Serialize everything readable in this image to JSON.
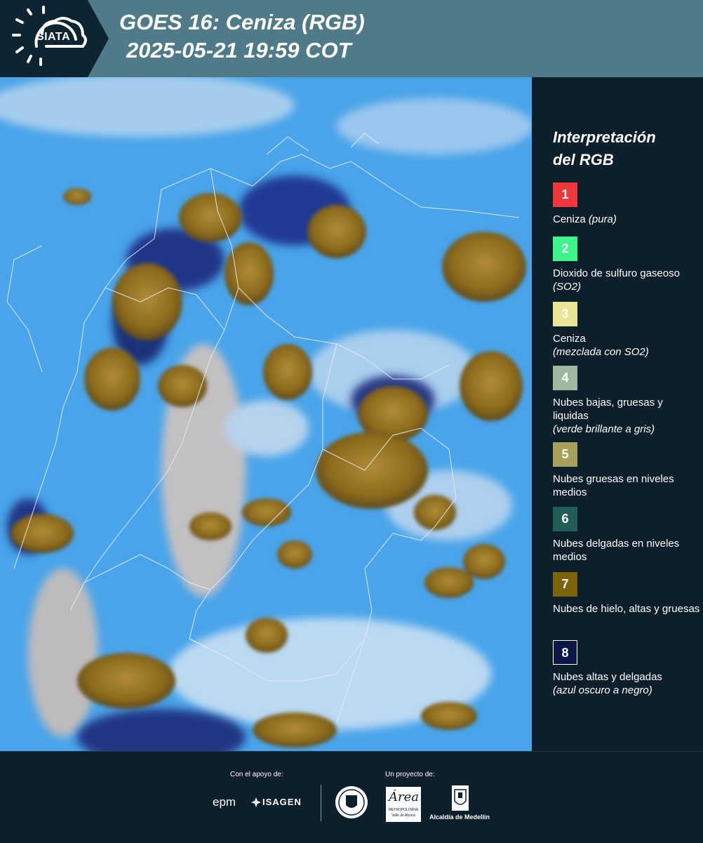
{
  "header": {
    "logo_text": "SIATA",
    "title_line1": "GOES 16: Ceniza (RGB)",
    "title_line2": "2025-05-21 19:59 COT"
  },
  "legend": {
    "title_line1": "Interpretación",
    "title_line2": "del RGB",
    "items": [
      {
        "number": "1",
        "color": "#f0373b",
        "label": "Ceniza",
        "note": "(pura)"
      },
      {
        "number": "2",
        "color": "#3df58a",
        "label": "Dioxido de sulfuro gaseoso",
        "note": "(SO2)"
      },
      {
        "number": "3",
        "color": "#e8e595",
        "label": "Ceniza",
        "note": "(mezclada con SO2)"
      },
      {
        "number": "4",
        "color": "#9fb89f",
        "label": "Nubes bajas, gruesas y liquidas",
        "note": "(verde brillante a gris)"
      },
      {
        "number": "5",
        "color": "#a5a15a",
        "label": "Nubes gruesas en niveles medios",
        "note": ""
      },
      {
        "number": "6",
        "color": "#225e57",
        "label": "Nubes delgadas en niveles medios",
        "note": ""
      },
      {
        "number": "7",
        "color": "#7d620c",
        "label": "Nubes de hielo, altas y gruesas",
        "note": ""
      },
      {
        "number": "8",
        "color": "#0b1547",
        "label": "Nubes altas y delgadas",
        "note": "(azul oscuro a negro)"
      }
    ]
  },
  "footer": {
    "support_label": "Con el apoyo de:",
    "project_label": "Un proyecto de:",
    "sponsor1": "epm",
    "sponsor2": "ISAGEN",
    "partner1_line1": "METROPOLITANA",
    "partner1_line2": "Valle de Aburrá",
    "partner1_script": "Área",
    "partner2": "Alcaldía de Medellín"
  },
  "colors": {
    "header_bg": "#4f7a87",
    "panel_bg": "#0d1f2b",
    "ocean_blue": "#49a3e8",
    "cloud_ochre": "#9a7a2a"
  }
}
